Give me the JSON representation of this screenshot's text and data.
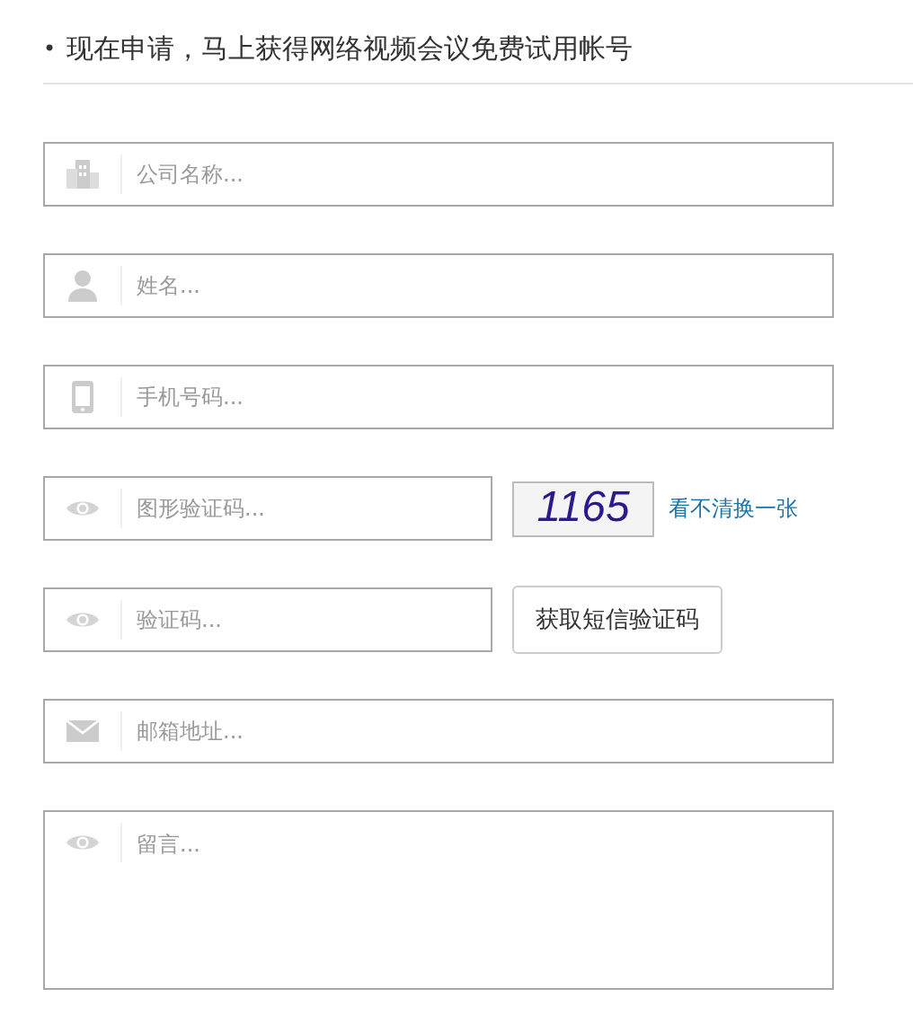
{
  "heading": {
    "bullet": "•",
    "text": "现在申请，马上获得网络视频会议免费试用帐号"
  },
  "fields": [
    {
      "kind": "text",
      "placeholder": "公司名称..."
    },
    {
      "kind": "text",
      "placeholder": "姓名..."
    },
    {
      "kind": "text",
      "placeholder": "手机号码..."
    },
    {
      "kind": "captcha",
      "placeholder": "图形验证码...",
      "captcha": "1165",
      "refresh": "看不清换一张"
    },
    {
      "kind": "sms",
      "placeholder": "验证码...",
      "button": "获取短信验证码"
    },
    {
      "kind": "text",
      "placeholder": "邮箱地址..."
    },
    {
      "kind": "textarea",
      "placeholder": "留言..."
    }
  ]
}
